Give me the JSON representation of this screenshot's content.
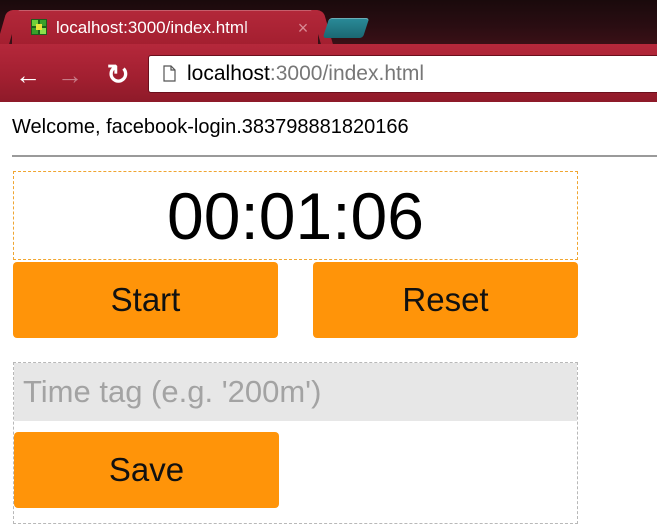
{
  "browser": {
    "tab_title": "localhost:3000/index.html",
    "tab_close": "×",
    "nav": {
      "back": "←",
      "forward": "→",
      "reload": "↻"
    },
    "url_host": "localhost",
    "url_rest": ":3000/index.html"
  },
  "header": {
    "welcome_text": "Welcome, facebook-login.383798881820166"
  },
  "stopwatch": {
    "time": "00:01:06",
    "start_label": "Start",
    "reset_label": "Reset"
  },
  "time_tag": {
    "value": "",
    "placeholder": "Time tag (e.g. '200m')",
    "save_label": "Save"
  },
  "colors": {
    "button": "#ff9409",
    "browser_accent": "#a41f30",
    "input_bg": "#e7e7e7"
  },
  "icons": {
    "favicon": "green-cube-icon",
    "page": "page-icon",
    "back": "back-arrow-icon",
    "forward": "forward-arrow-icon",
    "reload": "reload-icon",
    "close": "close-icon"
  }
}
